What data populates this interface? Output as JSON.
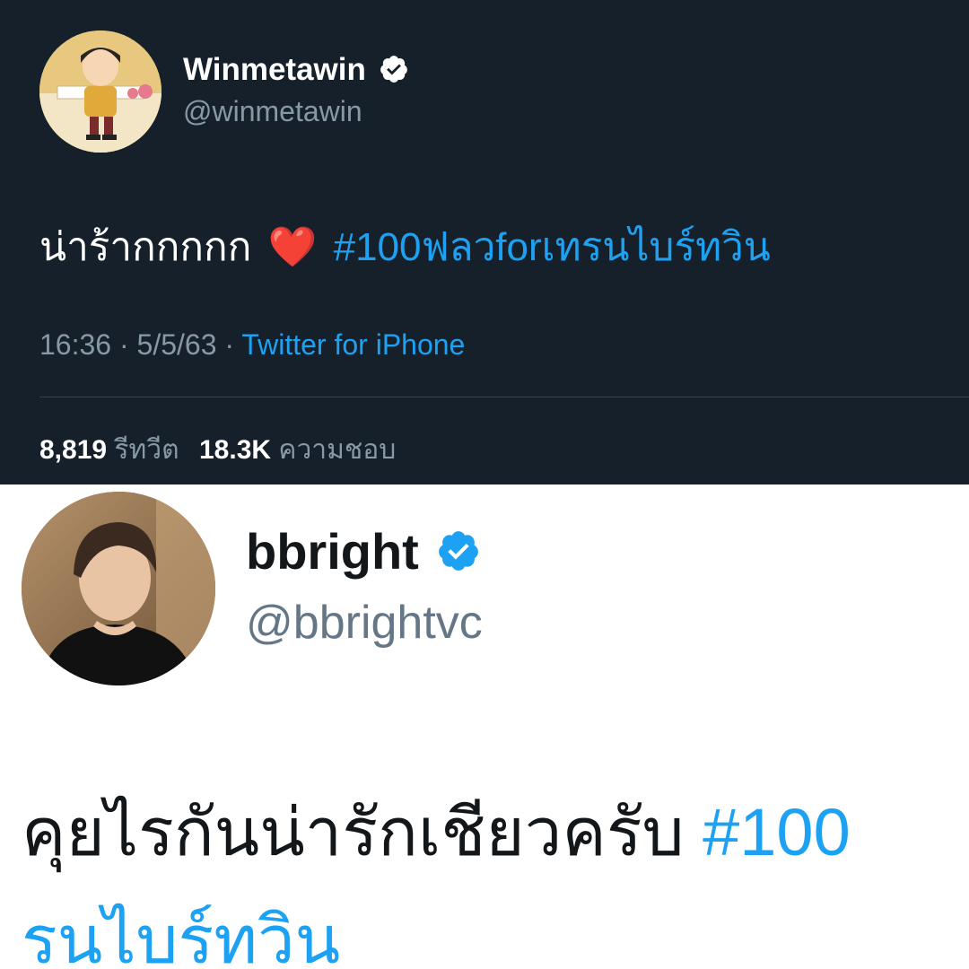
{
  "tweet1": {
    "name": "Winmetawin",
    "handle": "@winmetawin",
    "text_before": "น่าร้ากกกกก",
    "emoji": "❤️",
    "hashtag": "#100ฟลวforเทรนไบร์ทวิน",
    "time": "16:36",
    "sep1": "·",
    "date": "5/5/63",
    "sep2": "·",
    "source": "Twitter for iPhone",
    "retweets_count": "8,819",
    "retweets_label": "รีทวีต",
    "likes_count": "18.3K",
    "likes_label": "ความชอบ",
    "colors": {
      "background": "#15202b",
      "text": "#ffffff",
      "secondary": "#8899a6",
      "link": "#1da1f2"
    }
  },
  "tweet2": {
    "name": "bbright",
    "handle": "@bbrightvc",
    "text_before": "คุยไรกันน่ารักเชียวครับ",
    "hashtag_line1": "#100",
    "hashtag_line2": "รนไบร์ทวิน",
    "colors": {
      "background": "#ffffff",
      "text": "#14171a",
      "secondary": "#657786",
      "link": "#1da1f2"
    }
  }
}
